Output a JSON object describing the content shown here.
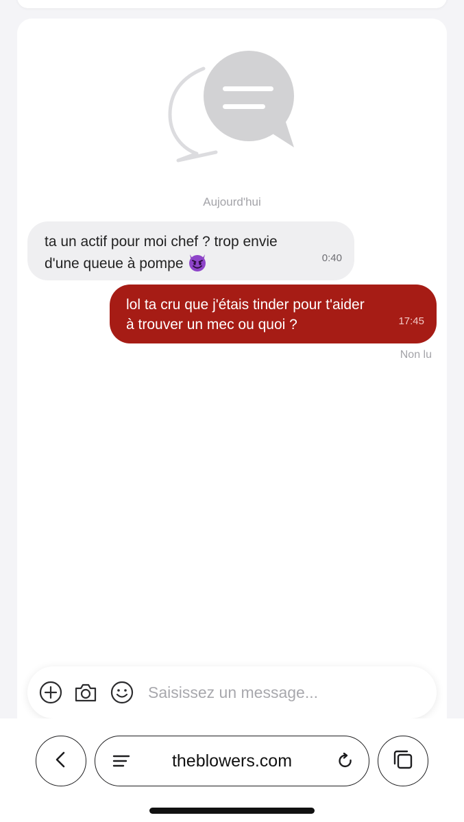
{
  "chat": {
    "day_label": "Aujourd'hui",
    "messages": [
      {
        "direction": "incoming",
        "lines": [
          "ta un actif pour moi chef ? trop envie",
          "d'une queue à pompe"
        ],
        "emoji": "smiling-imp",
        "time": "0:40"
      },
      {
        "direction": "outgoing",
        "lines": [
          "lol ta cru que j'étais tinder pour t'aider",
          "à trouver un mec ou quoi ?"
        ],
        "time": "17:45"
      }
    ],
    "read_status": "Non lu"
  },
  "composer": {
    "placeholder": "Saisissez un message...",
    "value": "",
    "icons": [
      "plus-circle-icon",
      "camera-icon",
      "smiley-icon"
    ]
  },
  "browser": {
    "url": "theblowers.com",
    "icons": [
      "chevron-left-icon",
      "menu-icon",
      "reload-icon",
      "tabs-icon"
    ]
  },
  "colors": {
    "outgoing_bubble": "#a61c15",
    "incoming_bubble": "#efeff1",
    "page_background": "#f4f4f7",
    "muted_text": "#a3a3a8"
  }
}
